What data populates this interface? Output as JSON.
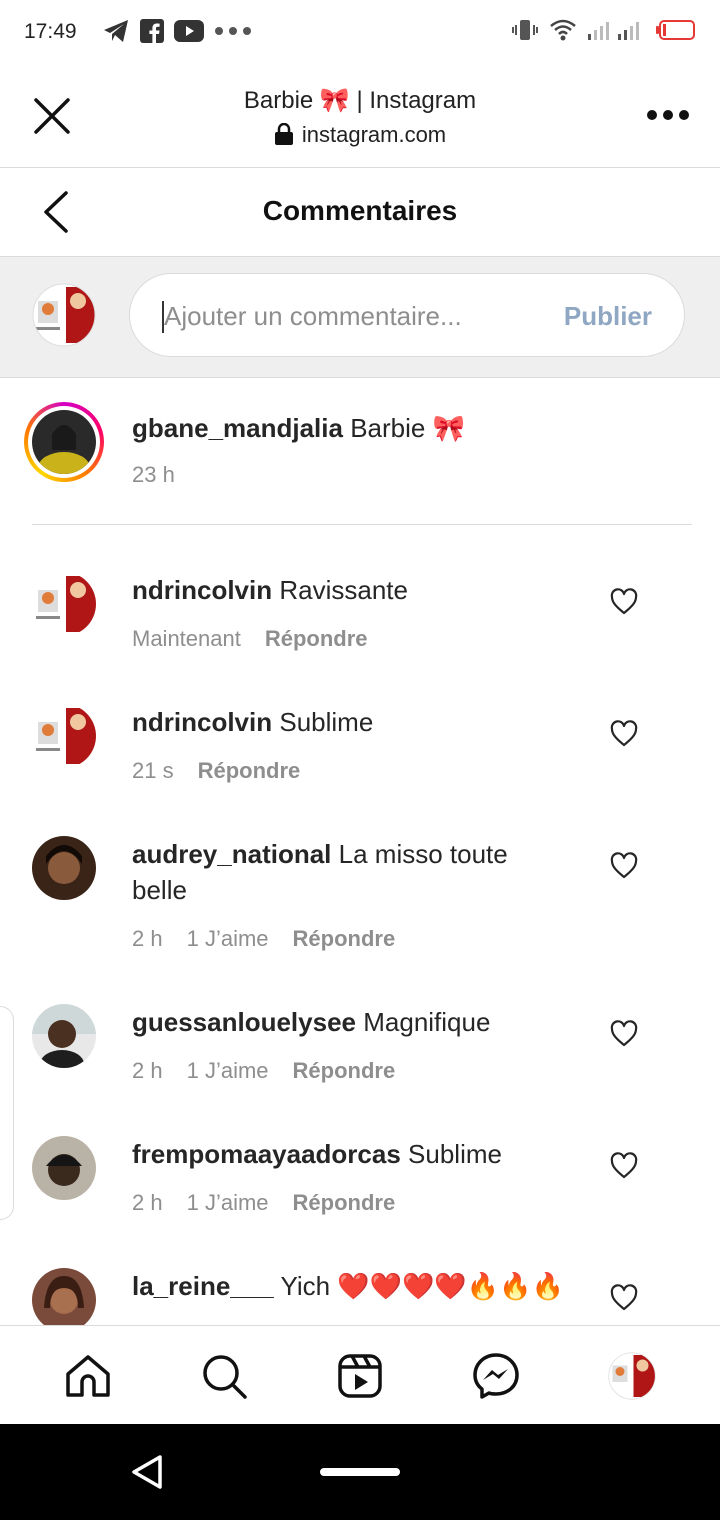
{
  "status_bar": {
    "time": "17:49"
  },
  "browser": {
    "title": "Barbie 🎀 | Instagram",
    "url": "instagram.com"
  },
  "header": {
    "title": "Commentaires"
  },
  "composer": {
    "placeholder": "Ajouter un commentaire...",
    "publish_label": "Publier"
  },
  "caption": {
    "username": "gbane_mandjalia",
    "text": "Barbie 🎀",
    "time": "23 h"
  },
  "comments": [
    {
      "username": "ndrincolvin",
      "text": "Ravissante",
      "time": "Maintenant",
      "likes": "",
      "reply": "Répondre"
    },
    {
      "username": "ndrincolvin",
      "text": "Sublime",
      "time": "21 s",
      "likes": "",
      "reply": "Répondre"
    },
    {
      "username": "audrey_national",
      "text": "La misso toute belle",
      "time": "2 h",
      "likes": "1 J’aime",
      "reply": "Répondre"
    },
    {
      "username": "guessanlouelysee",
      "text": "Magnifique",
      "time": "2 h",
      "likes": "1 J’aime",
      "reply": "Répondre"
    },
    {
      "username": "frempomaayaadorcas",
      "text": "Sublime",
      "time": "2 h",
      "likes": "1 J’aime",
      "reply": "Répondre"
    },
    {
      "username": "la_reine___",
      "text": "Yich ❤️❤️❤️❤️🔥🔥🔥",
      "time": "",
      "likes": "",
      "reply": ""
    }
  ],
  "icons": {
    "status": [
      "telegram-icon",
      "facebook-icon",
      "youtube-icon",
      "more-dots-icon",
      "vibrate-icon",
      "wifi-icon",
      "signal-icon",
      "battery-icon"
    ],
    "nav": [
      "home-icon",
      "search-icon",
      "reels-icon",
      "messenger-icon",
      "profile-avatar"
    ]
  },
  "colors": {
    "publish": "#8fa7c2",
    "secondary_text": "#8e8e8e",
    "battery": "#e53935"
  }
}
